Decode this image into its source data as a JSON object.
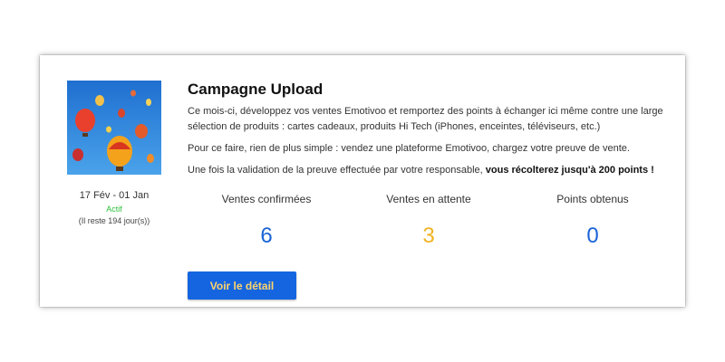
{
  "campaign": {
    "title": "Campagne Upload",
    "paragraph1": "Ce mois-ci, développez vos ventes Emotivoo et remportez des points à échanger ici même contre une large sélection de produits : cartes cadeaux, produits Hi Tech (iPhones, enceintes, téléviseurs, etc.)",
    "paragraph2": "Pour ce faire, rien de plus simple : vendez une plateforme Emotivoo, chargez votre preuve de vente.",
    "paragraph3_prefix": "Une fois la validation de la preuve effectuée par votre responsable, ",
    "paragraph3_bold": "vous récolterez jusqu'à 200 points !",
    "dates": "17 Fév - 01 Jan",
    "status": "Actif",
    "remaining": "(Il reste 194 jour(s))",
    "image_icon": "hot-air-balloons-image"
  },
  "stats": [
    {
      "label": "Ventes confirmées",
      "value": "6",
      "color": "#1a63d6"
    },
    {
      "label": "Ventes en attente",
      "value": "3",
      "color": "#f0b323"
    },
    {
      "label": "Points obtenus",
      "value": "0",
      "color": "#1a63d6"
    }
  ],
  "button": {
    "label": "Voir le détail",
    "text_color": "#ffd56b"
  },
  "colors": {
    "accent": "#1565e0",
    "status": "#2bbf3a"
  }
}
